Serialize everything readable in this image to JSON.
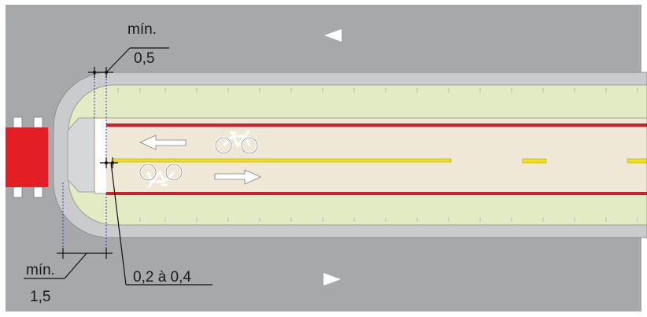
{
  "annotations": {
    "top_min": {
      "label": "mín.",
      "value": "0,5"
    },
    "bottom_min": {
      "label": "mín.",
      "value": "1,5"
    },
    "gap_range": {
      "value": "0,2 à 0,4"
    }
  },
  "colors": {
    "road": "#a6a8aa",
    "curb": "#c9cbcd",
    "buffer_green": "#e3ebc4",
    "bike_lane": "#efe8d6",
    "lane_edge_red": "#d01f2a",
    "center_line_yellow": "#f2e11a",
    "obstacle_red": "#e31e24",
    "arrow_white": "#ffffff",
    "dimension_line": "#111111",
    "guide_dotted": "#1f3fbf"
  },
  "symbols": [
    "arrow-left-icon",
    "arrow-right-icon",
    "bicycle-icon",
    "traffic-direction-arrow-icon"
  ]
}
